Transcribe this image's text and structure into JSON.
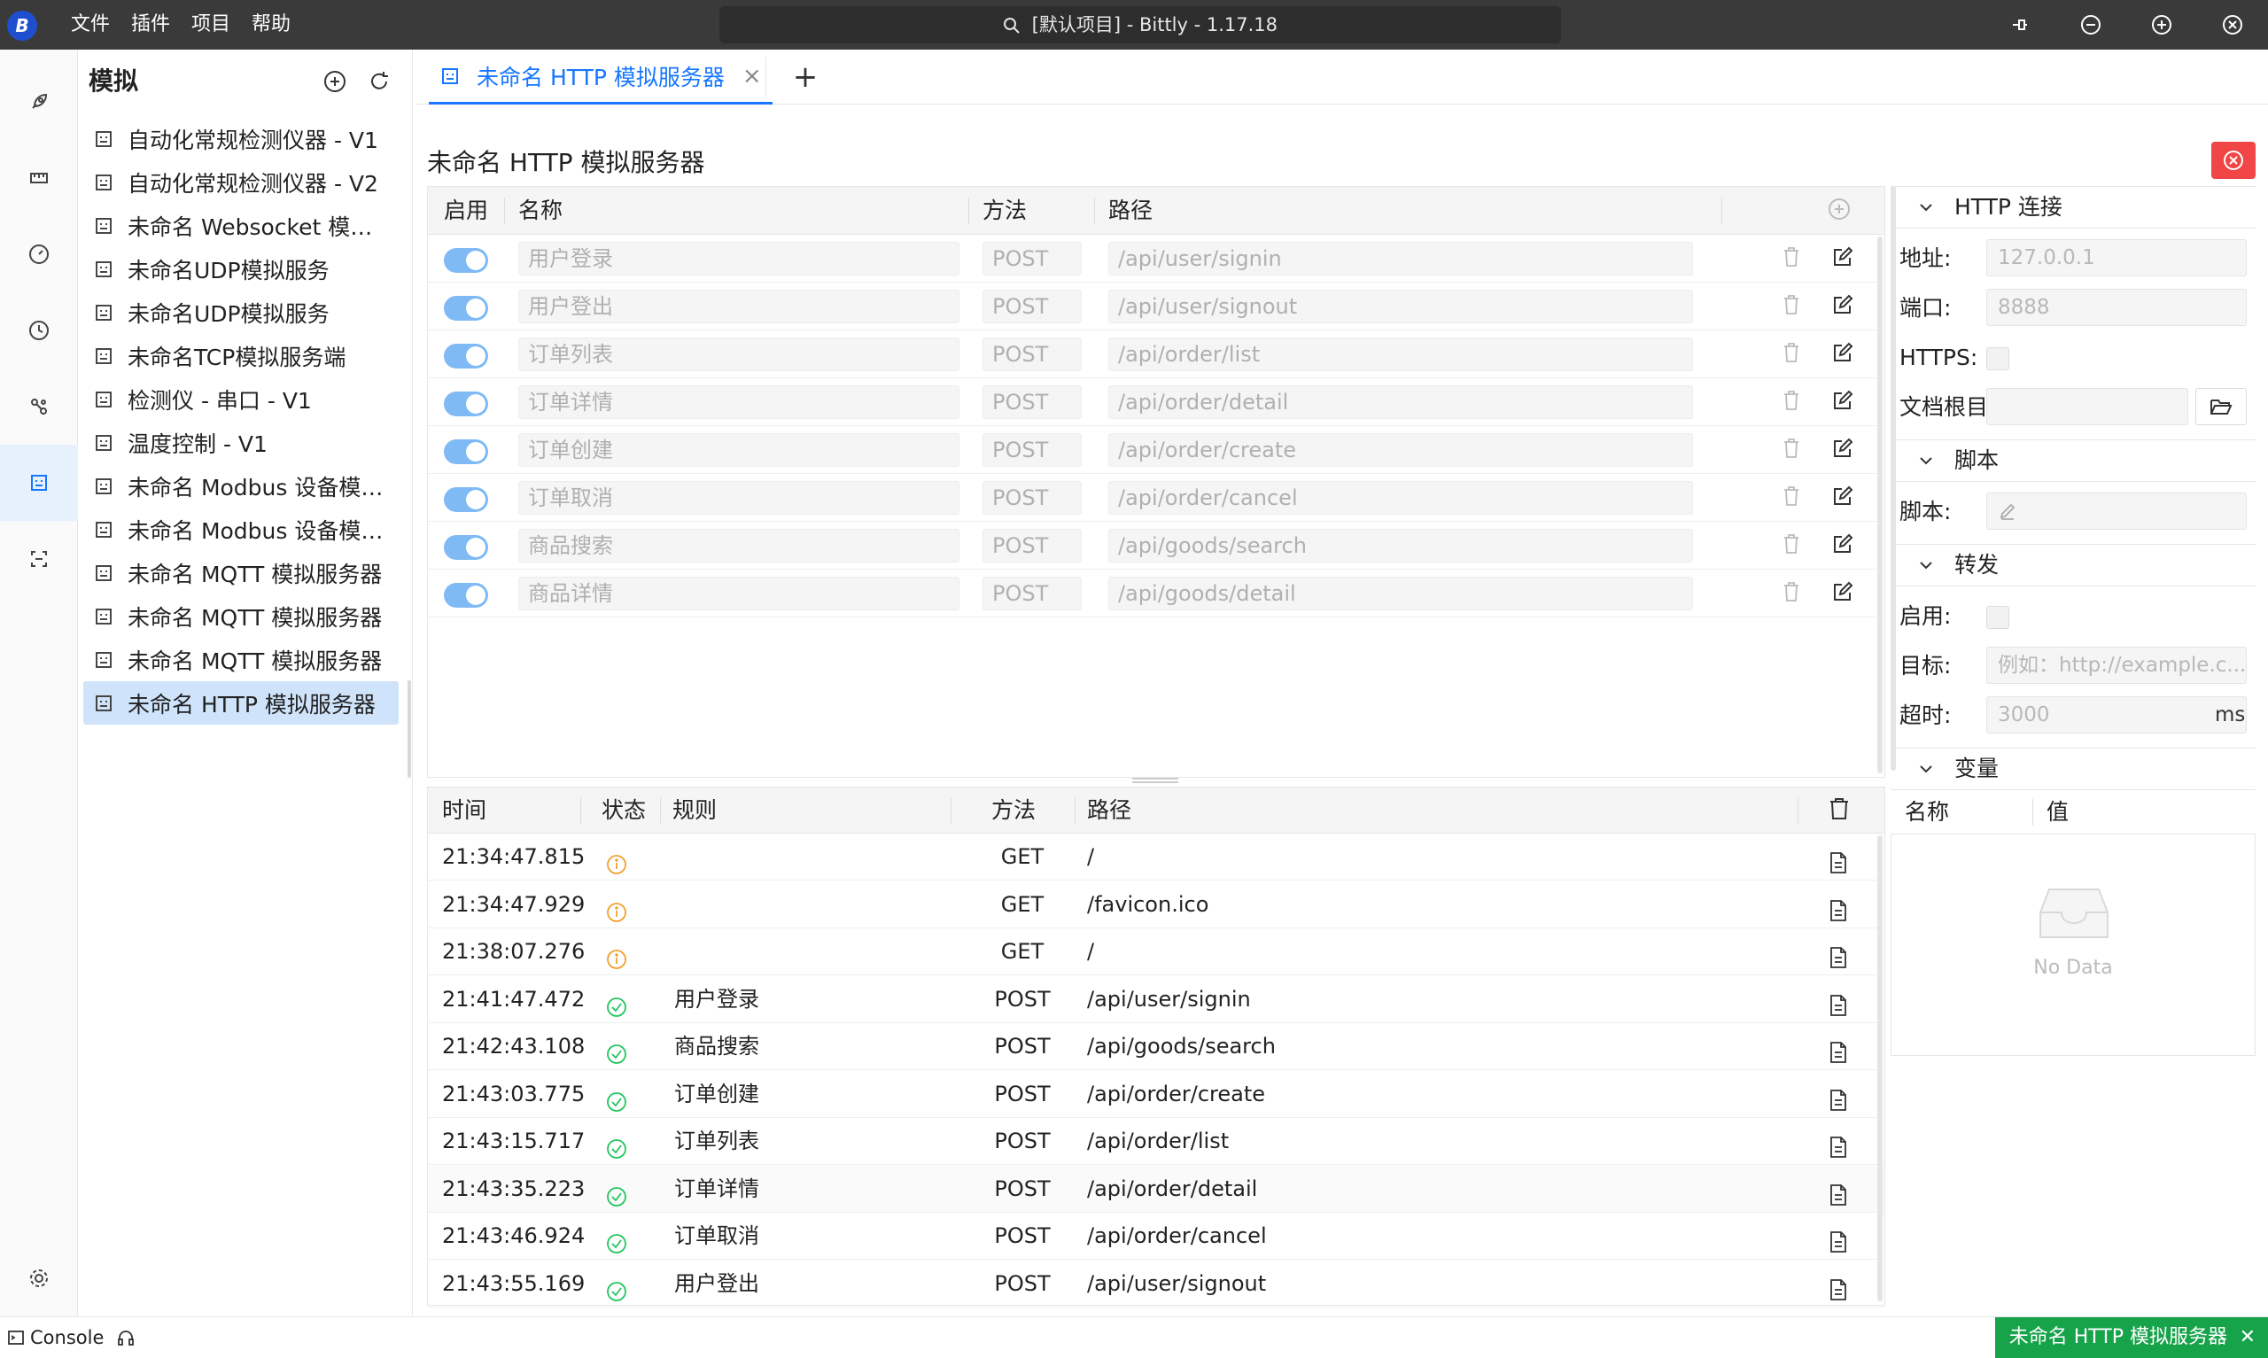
{
  "titlebar": {
    "logo_text": "B",
    "menu": [
      "文件",
      "插件",
      "项目",
      "帮助"
    ],
    "search_text": "[默认项目] - Bittly - 1.17.18"
  },
  "sidebar": {
    "title": "模拟",
    "items": [
      {
        "label": "自动化常规检测仪器 - V1"
      },
      {
        "label": "自动化常规检测仪器 - V2"
      },
      {
        "label": "未命名 Websocket 模拟服..."
      },
      {
        "label": "未命名UDP模拟服务"
      },
      {
        "label": "未命名UDP模拟服务"
      },
      {
        "label": "未命名TCP模拟服务端"
      },
      {
        "label": "检测仪 - 串口 - V1"
      },
      {
        "label": "温度控制 - V1"
      },
      {
        "label": "未命名 Modbus 设备模拟..."
      },
      {
        "label": "未命名 Modbus 设备模拟..."
      },
      {
        "label": "未命名 MQTT 模拟服务器"
      },
      {
        "label": "未命名 MQTT 模拟服务器"
      },
      {
        "label": "未命名 MQTT 模拟服务器"
      },
      {
        "label": "未命名 HTTP 模拟服务器",
        "active": true
      }
    ]
  },
  "tab": {
    "label": "未命名 HTTP 模拟服务器",
    "close": "×",
    "add": "+"
  },
  "page": {
    "title": "未命名 HTTP 模拟服务器"
  },
  "rules": {
    "headers": {
      "enabled": "启用",
      "name": "名称",
      "method": "方法",
      "path": "路径"
    },
    "rows": [
      {
        "name": "用户登录",
        "method": "POST",
        "path": "/api/user/signin",
        "enabled": true
      },
      {
        "name": "用户登出",
        "method": "POST",
        "path": "/api/user/signout",
        "enabled": true
      },
      {
        "name": "订单列表",
        "method": "POST",
        "path": "/api/order/list",
        "enabled": true
      },
      {
        "name": "订单详情",
        "method": "POST",
        "path": "/api/order/detail",
        "enabled": true
      },
      {
        "name": "订单创建",
        "method": "POST",
        "path": "/api/order/create",
        "enabled": true
      },
      {
        "name": "订单取消",
        "method": "POST",
        "path": "/api/order/cancel",
        "enabled": true
      },
      {
        "name": "商品搜索",
        "method": "POST",
        "path": "/api/goods/search",
        "enabled": true
      },
      {
        "name": "商品详情",
        "method": "POST",
        "path": "/api/goods/detail",
        "enabled": true
      }
    ]
  },
  "logs": {
    "headers": {
      "time": "时间",
      "status": "状态",
      "rule": "规则",
      "method": "方法",
      "path": "路径"
    },
    "rows": [
      {
        "time": "21:34:47.815",
        "status": "info",
        "rule": "",
        "method": "GET",
        "path": "/"
      },
      {
        "time": "21:34:47.929",
        "status": "info",
        "rule": "",
        "method": "GET",
        "path": "/favicon.ico"
      },
      {
        "time": "21:38:07.276",
        "status": "info",
        "rule": "",
        "method": "GET",
        "path": "/"
      },
      {
        "time": "21:41:47.472",
        "status": "success",
        "rule": "用户登录",
        "method": "POST",
        "path": "/api/user/signin"
      },
      {
        "time": "21:42:43.108",
        "status": "success",
        "rule": "商品搜索",
        "method": "POST",
        "path": "/api/goods/search"
      },
      {
        "time": "21:43:03.775",
        "status": "success",
        "rule": "订单创建",
        "method": "POST",
        "path": "/api/order/create"
      },
      {
        "time": "21:43:15.717",
        "status": "success",
        "rule": "订单列表",
        "method": "POST",
        "path": "/api/order/list"
      },
      {
        "time": "21:43:35.223",
        "status": "success",
        "rule": "订单详情",
        "method": "POST",
        "path": "/api/order/detail"
      },
      {
        "time": "21:43:46.924",
        "status": "success",
        "rule": "订单取消",
        "method": "POST",
        "path": "/api/order/cancel"
      },
      {
        "time": "21:43:55.169",
        "status": "success",
        "rule": "用户登出",
        "method": "POST",
        "path": "/api/user/signout"
      }
    ]
  },
  "panel": {
    "http": {
      "title": "HTTP 连接",
      "address_label": "地址:",
      "address_placeholder": "127.0.0.1",
      "port_label": "端口:",
      "port_placeholder": "8888",
      "https_label": "HTTPS:",
      "docroot_label": "文档根目"
    },
    "script": {
      "title": "脚本",
      "label": "脚本:"
    },
    "forward": {
      "title": "转发",
      "enabled_label": "启用:",
      "target_label": "目标:",
      "target_placeholder": "例如：http://example.c...",
      "timeout_label": "超时:",
      "timeout_placeholder": "3000",
      "timeout_unit": "ms"
    },
    "variables": {
      "title": "变量",
      "col_name": "名称",
      "col_value": "值",
      "empty": "No Data"
    }
  },
  "statusbar": {
    "console": "Console",
    "server": "未命名 HTTP 模拟服务器"
  },
  "colors": {
    "accent": "#1677ff",
    "success": "#22c55e",
    "info": "#f0a030",
    "danger": "#f04646",
    "server_badge": "#16a34a"
  }
}
